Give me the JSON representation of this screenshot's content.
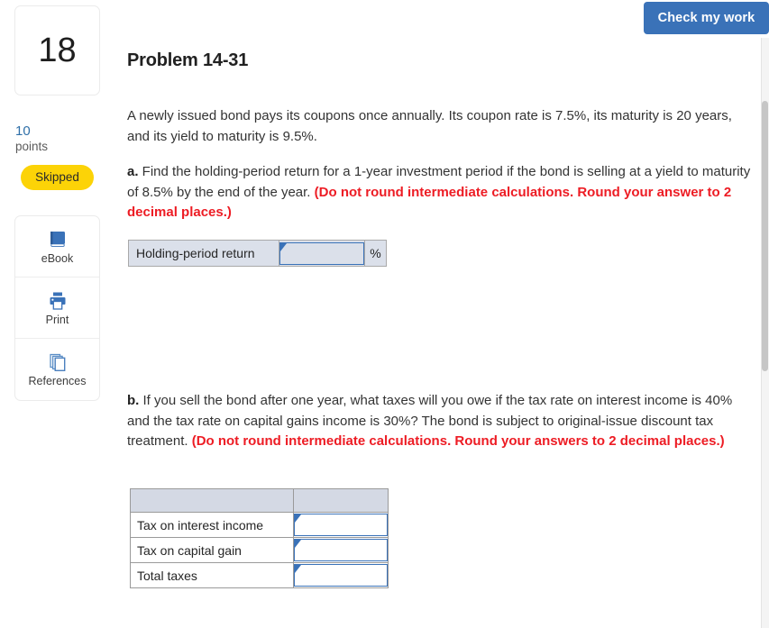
{
  "header": {
    "check_my_work_label": "Check my work"
  },
  "sidebar": {
    "question_number": "18",
    "points_value": "10",
    "points_label": "points",
    "status_badge": "Skipped",
    "tools": [
      {
        "label": "eBook",
        "icon": "ebook-icon"
      },
      {
        "label": "Print",
        "icon": "print-icon"
      },
      {
        "label": "References",
        "icon": "references-icon"
      }
    ]
  },
  "main": {
    "title": "Problem 14-31",
    "intro": "A newly issued bond pays its coupons once annually. Its coupon rate is 7.5%, its maturity is 20 years, and its yield to maturity is 9.5%.",
    "part_a": {
      "marker": "a.",
      "text": " Find the holding-period return for a 1-year investment period if the bond is selling at a yield to maturity of 8.5% by the end of the year. ",
      "note": "(Do not round intermediate calculations. Round your answer to 2 decimal places.)",
      "table": {
        "row_label": "Holding-period return",
        "input_value": "",
        "input_placeholder": "",
        "unit": "%"
      }
    },
    "part_b": {
      "marker": "b.",
      "text": " If you sell the bond after one year, what taxes will you owe if the tax rate on interest income is 40% and the tax rate on capital gains income is 30%? The bond is subject to original-issue discount tax treatment. ",
      "note": "(Do not round intermediate calculations. Round your answers to 2 decimal places.)",
      "table": {
        "headers": [
          "",
          ""
        ],
        "rows": [
          {
            "label": "Tax on interest income",
            "value": "",
            "placeholder": ""
          },
          {
            "label": "Tax on capital gain",
            "value": "",
            "placeholder": ""
          },
          {
            "label": "Total taxes",
            "value": "",
            "placeholder": ""
          }
        ]
      }
    }
  },
  "colors": {
    "accent_blue": "#3a72b8",
    "badge_yellow": "#fcd307",
    "note_red": "#ed1c24",
    "field_fill": "#dbe0ea"
  }
}
